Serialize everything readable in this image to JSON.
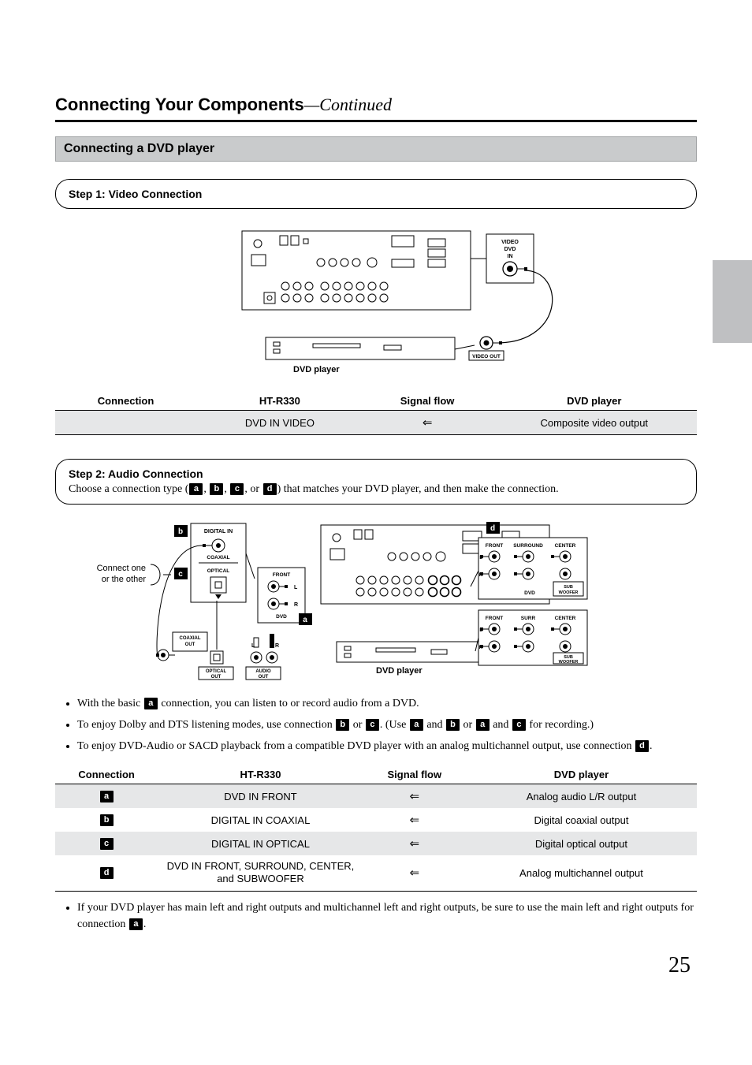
{
  "header": {
    "title": "Connecting Your Components",
    "continued": "—Continued"
  },
  "section_bar": "Connecting a DVD player",
  "side_tab": "",
  "page_number": "25",
  "step1": {
    "title": "Step 1: Video Connection",
    "diagram": {
      "dvd_label": "DVD player",
      "video_out": "VIDEO OUT",
      "video_dvd_in": "VIDEO\nDVD\nIN"
    },
    "table": {
      "headers": {
        "c1": "Connection",
        "c2": "HT-R330",
        "c3": "Signal flow",
        "c4": "DVD player"
      },
      "row": {
        "c1": "",
        "c2": "DVD IN VIDEO",
        "c3": "⇐",
        "c4": "Composite video output"
      }
    }
  },
  "step2": {
    "title": "Step 2: Audio Connection",
    "sub_pre": "Choose a connection type (",
    "sub_mid1": ", ",
    "sub_mid2": ", ",
    "sub_mid3": ", or ",
    "sub_post": ") that matches your DVD player, and then make the connection.",
    "chips": {
      "a": "a",
      "b": "b",
      "c": "c",
      "d": "d"
    },
    "diagram": {
      "connect_note1": "Connect one",
      "connect_note2": "or the other",
      "digital_in": "DIGITAL IN",
      "coaxial": "COAXIAL",
      "optical": "OPTICAL",
      "coaxial_out": "COAXIAL\nOUT",
      "optical_out": "OPTICAL\nOUT",
      "audio_out": "AUDIO\nOUT",
      "front": "FRONT",
      "dvd": "DVD",
      "l": "L",
      "r": "R",
      "dvd_player": "DVD player",
      "surround": "SURROUND",
      "surr": "SURR",
      "center": "CENTER",
      "subwoofer": "SUB\nWOOFER"
    },
    "bullets": {
      "b1": {
        "pre": "With the basic ",
        "post": " connection, you can listen to or record audio from a DVD."
      },
      "b2": {
        "pre": "To enjoy Dolby and DTS listening modes, use connection ",
        "mid1": " or ",
        "mid2": ". (Use ",
        "mid3": " and ",
        "mid4": " or ",
        "mid5": " and ",
        "post": " for recording.)"
      },
      "b3": {
        "pre": "To enjoy DVD-Audio or SACD playback from a compatible DVD player with an analog multichannel output, use connection ",
        "post": "."
      }
    },
    "table": {
      "headers": {
        "c1": "Connection",
        "c2": "HT-R330",
        "c3": "Signal flow",
        "c4": "DVD player"
      },
      "rows": [
        {
          "chip": "a",
          "c2": "DVD IN FRONT",
          "c3": "⇐",
          "c4": "Analog audio L/R output",
          "shade": true
        },
        {
          "chip": "b",
          "c2": "DIGITAL IN COAXIAL",
          "c3": "⇐",
          "c4": "Digital coaxial output",
          "shade": false
        },
        {
          "chip": "c",
          "c2": "DIGITAL IN OPTICAL",
          "c3": "⇐",
          "c4": "Digital optical output",
          "shade": true
        },
        {
          "chip": "d",
          "c2": "DVD IN FRONT, SURROUND, CENTER, and SUBWOOFER",
          "c3": "⇐",
          "c4": "Analog multichannel output",
          "shade": false
        }
      ]
    },
    "tail": {
      "pre": "If your DVD player has main left and right outputs and multichannel left and right outputs, be sure to use the main left and right outputs for connection ",
      "post": "."
    }
  }
}
